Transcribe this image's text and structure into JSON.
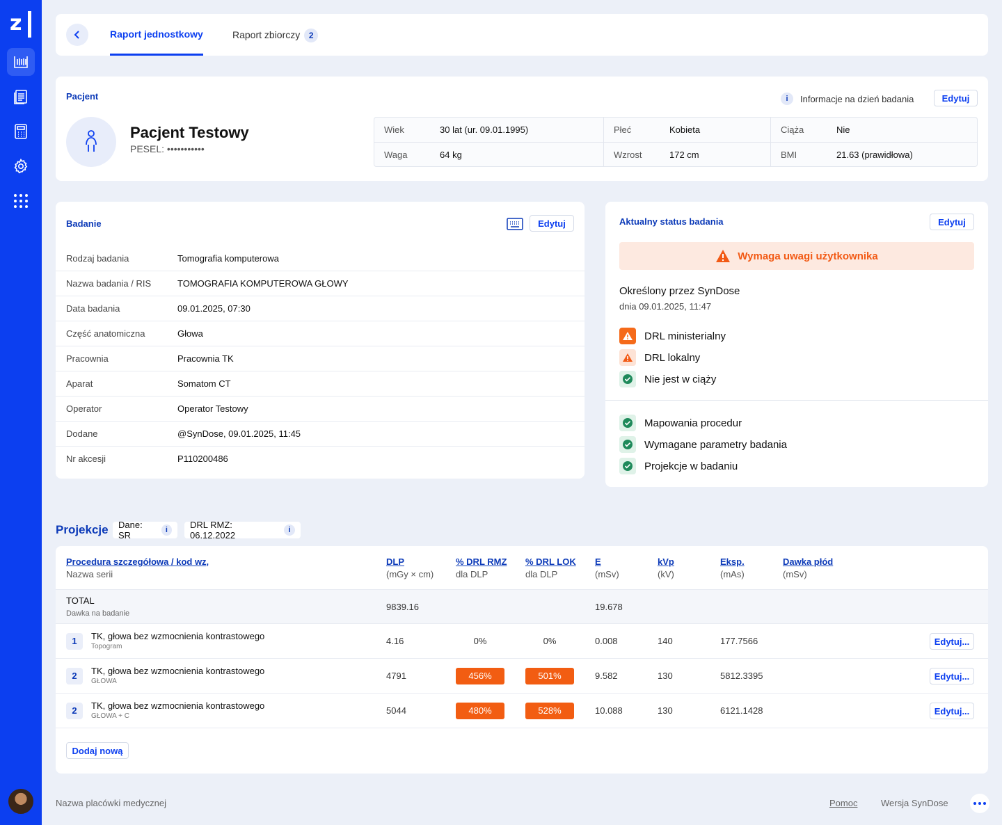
{
  "colors": {
    "sidebar": "#0c3ff0",
    "accent": "#0c3ab8",
    "warning": "#f25a15",
    "success": "#1f8a5b"
  },
  "sidebar": {
    "logo": "z",
    "items": [
      {
        "icon": "barcode-icon",
        "active": true
      },
      {
        "icon": "document-list-icon",
        "active": false
      },
      {
        "icon": "calculator-icon",
        "active": false
      },
      {
        "icon": "gear-icon",
        "active": false
      },
      {
        "icon": "apps-grid-icon",
        "active": false
      }
    ]
  },
  "tabs": [
    {
      "label": "Raport jednostkowy",
      "active": true
    },
    {
      "label": "Raport zbiorczy",
      "count": "2",
      "active": false
    }
  ],
  "patient": {
    "section_title": "Pacjent",
    "name": "Pacjent Testowy",
    "pesel": "PESEL: •••••••••••",
    "info_icon": "i",
    "info_text": "Informacje na dzień badania",
    "edit_label": "Edytuj",
    "fields": {
      "age_label": "Wiek",
      "age": "30 lat (ur. 09.01.1995)",
      "sex_label": "Płeć",
      "sex": "Kobieta",
      "pregnancy_label": "Ciąża",
      "pregnancy": "Nie",
      "weight_label": "Waga",
      "weight": "64 kg",
      "height_label": "Wzrost",
      "height": "172 cm",
      "bmi_label": "BMI",
      "bmi": "21.63 (prawidłowa)"
    }
  },
  "exam": {
    "section_title": "Badanie",
    "edit_label": "Edytuj",
    "rows": [
      {
        "label": "Rodzaj badania",
        "value": "Tomografia komputerowa"
      },
      {
        "label": "Nazwa badania / RIS",
        "value": "TOMOGRAFIA KOMPUTEROWA GŁOWY"
      },
      {
        "label": "Data badania",
        "value": "09.01.2025, 07:30"
      },
      {
        "label": "Część anatomiczna",
        "value": "Głowa"
      },
      {
        "label": "Pracownia",
        "value": "Pracownia TK"
      },
      {
        "label": "Aparat",
        "value": "Somatom CT"
      },
      {
        "label": "Operator",
        "value": "Operator Testowy"
      },
      {
        "label": "Dodane",
        "value": "@SynDose, 09.01.2025, 11:45"
      },
      {
        "label": "Nr akcesji",
        "value": "P110200486"
      }
    ]
  },
  "status": {
    "section_title": "Aktualny status badania",
    "edit_label": "Edytuj",
    "banner": "Wymaga uwagi użytkownika",
    "determined_by": "Określony przez SynDose",
    "determined_date": "dnia 09.01.2025, 11:47",
    "checks": [
      {
        "label": "DRL ministerialny",
        "state": "warning"
      },
      {
        "label": "DRL lokalny",
        "state": "warning-light"
      },
      {
        "label": "Nie jest w ciąży",
        "state": "ok"
      }
    ],
    "validations": [
      {
        "label": "Mapowania procedur",
        "state": "ok"
      },
      {
        "label": "Wymagane parametry badania",
        "state": "ok"
      },
      {
        "label": "Projekcje w badaniu",
        "state": "ok"
      }
    ]
  },
  "projections": {
    "title": "Projekcje",
    "chip_data": "Dane: SR",
    "chip_drl": "DRL RMZ: 06.12.2022",
    "chip_info": "i",
    "headers": [
      {
        "h": "Procedura szczegółowa / kod wz,",
        "s": "Nazwa serii"
      },
      {
        "h": "DLP",
        "s": "(mGy × cm)"
      },
      {
        "h": "% DRL RMZ",
        "s": "dla DLP"
      },
      {
        "h": "% DRL LOK",
        "s": "dla DLP"
      },
      {
        "h": "E",
        "s": "(mSv)"
      },
      {
        "h": "kVp",
        "s": "(kV)"
      },
      {
        "h": "Eksp.",
        "s": "(mAs)"
      },
      {
        "h": "Dawka płód",
        "s": "(mSv)"
      }
    ],
    "total": {
      "label": "TOTAL",
      "sub": "Dawka na badanie",
      "dlp": "9839.16",
      "e": "19.678"
    },
    "rows": [
      {
        "num": "1",
        "name": "TK, głowa bez wzmocnienia kontrastowego",
        "series": "Topogram",
        "dlp": "4.16",
        "drl_rmz": "0%",
        "drl_lok": "0%",
        "rmz_high": false,
        "lok_high": false,
        "e": "0.008",
        "kvp": "140",
        "exp": "177.7566",
        "edit": "Edytuj..."
      },
      {
        "num": "2",
        "name": "TK, głowa bez wzmocnienia kontrastowego",
        "series": "GŁOWA",
        "dlp": "4791",
        "drl_rmz": "456%",
        "drl_lok": "501%",
        "rmz_high": true,
        "lok_high": true,
        "e": "9.582",
        "kvp": "130",
        "exp": "5812.3395",
        "edit": "Edytuj..."
      },
      {
        "num": "2",
        "name": "TK, głowa bez wzmocnienia kontrastowego",
        "series": "GŁOWA + C",
        "dlp": "5044",
        "drl_rmz": "480%",
        "drl_lok": "528%",
        "rmz_high": true,
        "lok_high": true,
        "e": "10.088",
        "kvp": "130",
        "exp": "6121.1428",
        "edit": "Edytuj..."
      }
    ],
    "add_label": "Dodaj nową"
  },
  "footer": {
    "facility": "Nazwa placówki medycznej",
    "help": "Pomoc",
    "version": "Wersja SynDose"
  }
}
